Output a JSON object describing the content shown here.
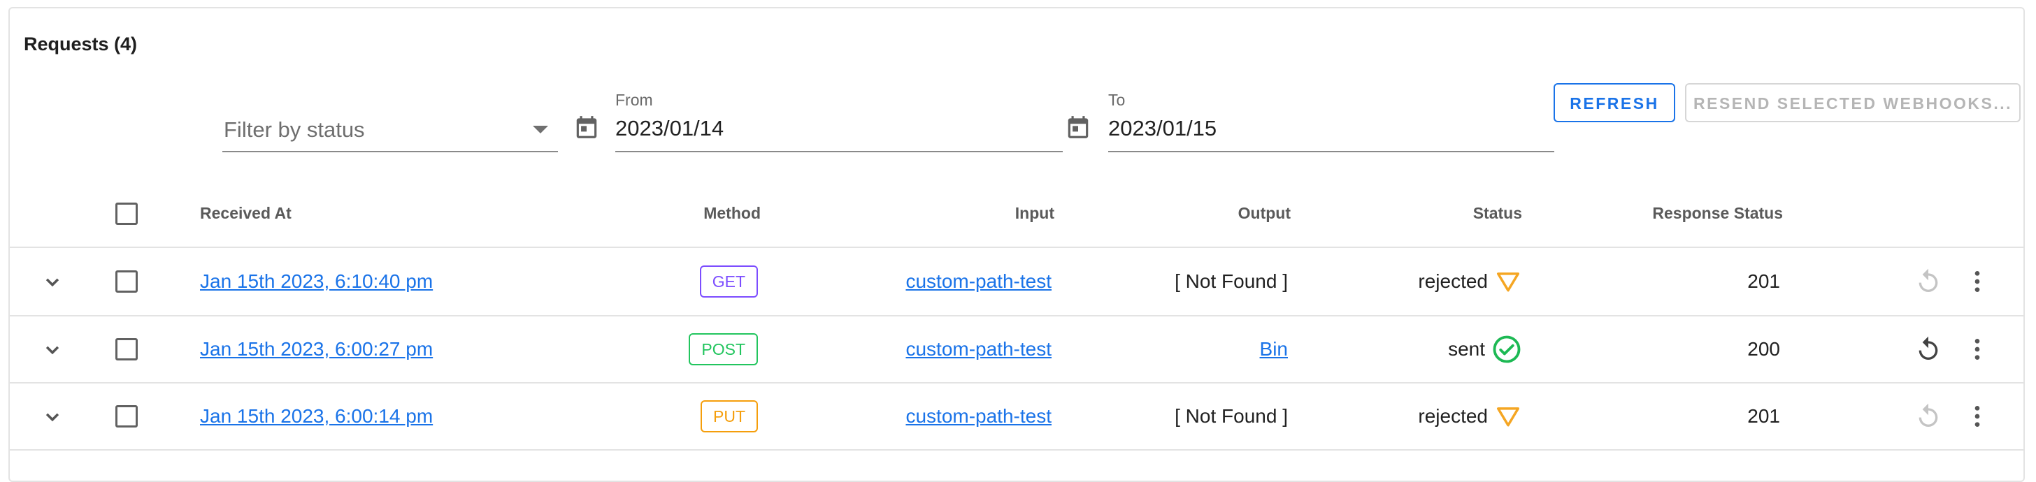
{
  "header": {
    "title": "Requests (4)"
  },
  "filters": {
    "status_placeholder": "Filter by status",
    "from_label": "From",
    "from_value": "2023/01/14",
    "to_label": "To",
    "to_value": "2023/01/15"
  },
  "buttons": {
    "refresh": "REFRESH",
    "resend": "RESEND SELECTED WEBHOOKS..."
  },
  "table": {
    "columns": {
      "received_at": "Received At",
      "method": "Method",
      "input": "Input",
      "output": "Output",
      "status": "Status",
      "response_status": "Response Status"
    },
    "rows": [
      {
        "received_at": "Jan 15th 2023, 6:10:40 pm",
        "method": "GET",
        "input": "custom-path-test",
        "output": "[ Not Found ]",
        "output_is_link": false,
        "status": "rejected",
        "status_icon": "warning-triangle-icon",
        "response_status": "201",
        "resend_enabled": false
      },
      {
        "received_at": "Jan 15th 2023, 6:00:27 pm",
        "method": "POST",
        "input": "custom-path-test",
        "output": "Bin",
        "output_is_link": true,
        "status": "sent",
        "status_icon": "check-circle-icon",
        "response_status": "200",
        "resend_enabled": true
      },
      {
        "received_at": "Jan 15th 2023, 6:00:14 pm",
        "method": "PUT",
        "input": "custom-path-test",
        "output": "[ Not Found ]",
        "output_is_link": false,
        "status": "rejected",
        "status_icon": "warning-triangle-icon",
        "response_status": "201",
        "resend_enabled": false
      }
    ]
  },
  "colors": {
    "accent": "#1a73e8",
    "get": "#7c4dff",
    "post": "#22c55e",
    "put": "#f59e0b",
    "warning": "#f5a623",
    "success": "#1db954"
  }
}
